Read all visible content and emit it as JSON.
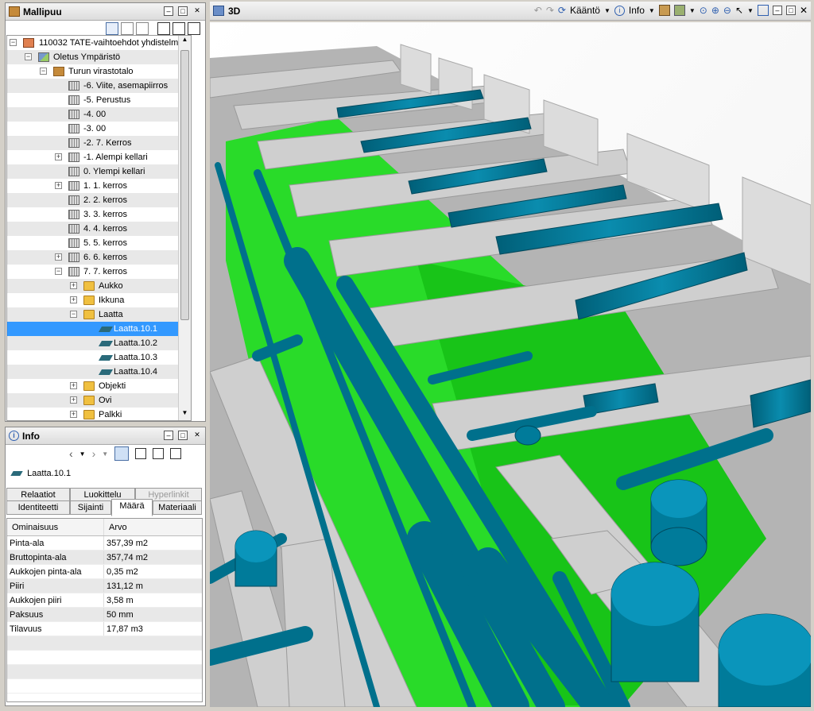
{
  "model_tree": {
    "title": "Mallipuu",
    "items": [
      {
        "label": "110032 TATE-vaihtoehdot yhdistelm"
      },
      {
        "label": "Oletus Ympäristö"
      },
      {
        "label": "Turun virastotalo"
      },
      {
        "label": "-6. Viite, asemapiirros"
      },
      {
        "label": "-5. Perustus"
      },
      {
        "label": "-4. 00"
      },
      {
        "label": "-3. 00"
      },
      {
        "label": "-2. 7. Kerros"
      },
      {
        "label": "-1. Alempi kellari"
      },
      {
        "label": "0. Ylempi kellari"
      },
      {
        "label": "1. 1. kerros"
      },
      {
        "label": "2. 2. kerros"
      },
      {
        "label": "3. 3. kerros"
      },
      {
        "label": "4. 4. kerros"
      },
      {
        "label": "5. 5. kerros"
      },
      {
        "label": "6. 6. kerros"
      },
      {
        "label": "7. 7. kerros"
      },
      {
        "label": "Aukko"
      },
      {
        "label": "Ikkuna"
      },
      {
        "label": "Laatta"
      },
      {
        "label": "Laatta.10.1"
      },
      {
        "label": "Laatta.10.2"
      },
      {
        "label": "Laatta.10.3"
      },
      {
        "label": "Laatta.10.4"
      },
      {
        "label": "Objekti"
      },
      {
        "label": "Ovi"
      },
      {
        "label": "Palkki"
      }
    ]
  },
  "info": {
    "title": "Info",
    "selected": "Laatta.10.1",
    "tabs_row1": [
      "Relaatiot",
      "Luokittelu",
      "Hyperlinkit"
    ],
    "tabs_row2": [
      "Identiteetti",
      "Sijainti",
      "Määrä",
      "Materiaali"
    ],
    "col_property": "Ominaisuus",
    "col_value": "Arvo",
    "rows": [
      {
        "name": "Pinta-ala",
        "value": "357,39 m2"
      },
      {
        "name": "Bruttopinta-ala",
        "value": "357,74 m2"
      },
      {
        "name": "Aukkojen pinta-ala",
        "value": "0,35 m2"
      },
      {
        "name": "Piiri",
        "value": "131,12 m"
      },
      {
        "name": "Aukkojen piiri",
        "value": "3,58 m"
      },
      {
        "name": "Paksuus",
        "value": "50 mm"
      },
      {
        "name": "Tilavuus",
        "value": "17,87 m3"
      }
    ]
  },
  "viewer": {
    "title": "3D",
    "rotate_label": "Kääntö",
    "info_label": "Info"
  },
  "colors": {
    "duct": "#007b9a",
    "floor": "#22dd22",
    "wall": "#c8c8c8",
    "selection": "#3399ff"
  }
}
